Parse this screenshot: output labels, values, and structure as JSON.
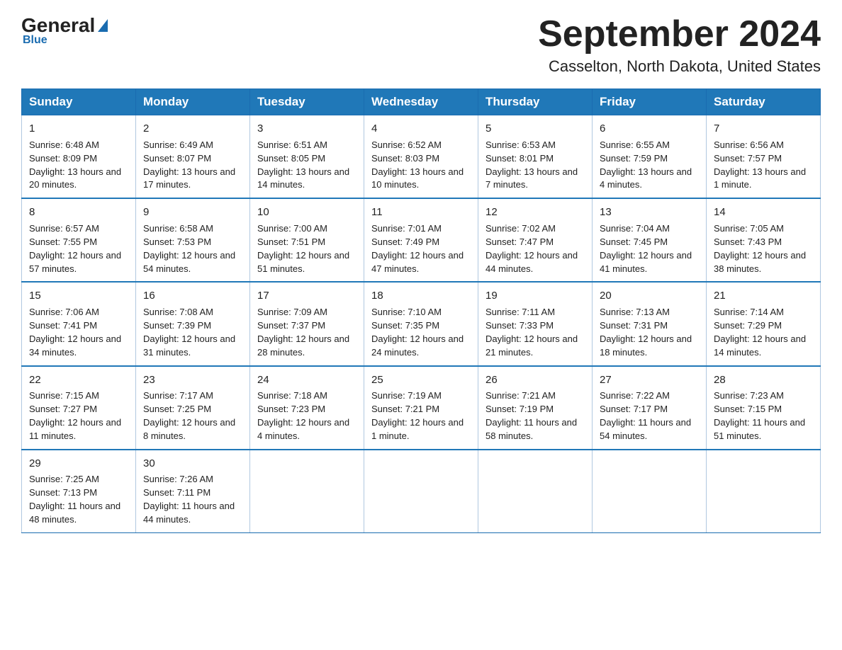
{
  "header": {
    "logo_general": "General",
    "logo_blue": "Blue",
    "month_title": "September 2024",
    "location": "Casselton, North Dakota, United States"
  },
  "days_of_week": [
    "Sunday",
    "Monday",
    "Tuesday",
    "Wednesday",
    "Thursday",
    "Friday",
    "Saturday"
  ],
  "weeks": [
    [
      {
        "day": "1",
        "sunrise": "Sunrise: 6:48 AM",
        "sunset": "Sunset: 8:09 PM",
        "daylight": "Daylight: 13 hours and 20 minutes."
      },
      {
        "day": "2",
        "sunrise": "Sunrise: 6:49 AM",
        "sunset": "Sunset: 8:07 PM",
        "daylight": "Daylight: 13 hours and 17 minutes."
      },
      {
        "day": "3",
        "sunrise": "Sunrise: 6:51 AM",
        "sunset": "Sunset: 8:05 PM",
        "daylight": "Daylight: 13 hours and 14 minutes."
      },
      {
        "day": "4",
        "sunrise": "Sunrise: 6:52 AM",
        "sunset": "Sunset: 8:03 PM",
        "daylight": "Daylight: 13 hours and 10 minutes."
      },
      {
        "day": "5",
        "sunrise": "Sunrise: 6:53 AM",
        "sunset": "Sunset: 8:01 PM",
        "daylight": "Daylight: 13 hours and 7 minutes."
      },
      {
        "day": "6",
        "sunrise": "Sunrise: 6:55 AM",
        "sunset": "Sunset: 7:59 PM",
        "daylight": "Daylight: 13 hours and 4 minutes."
      },
      {
        "day": "7",
        "sunrise": "Sunrise: 6:56 AM",
        "sunset": "Sunset: 7:57 PM",
        "daylight": "Daylight: 13 hours and 1 minute."
      }
    ],
    [
      {
        "day": "8",
        "sunrise": "Sunrise: 6:57 AM",
        "sunset": "Sunset: 7:55 PM",
        "daylight": "Daylight: 12 hours and 57 minutes."
      },
      {
        "day": "9",
        "sunrise": "Sunrise: 6:58 AM",
        "sunset": "Sunset: 7:53 PM",
        "daylight": "Daylight: 12 hours and 54 minutes."
      },
      {
        "day": "10",
        "sunrise": "Sunrise: 7:00 AM",
        "sunset": "Sunset: 7:51 PM",
        "daylight": "Daylight: 12 hours and 51 minutes."
      },
      {
        "day": "11",
        "sunrise": "Sunrise: 7:01 AM",
        "sunset": "Sunset: 7:49 PM",
        "daylight": "Daylight: 12 hours and 47 minutes."
      },
      {
        "day": "12",
        "sunrise": "Sunrise: 7:02 AM",
        "sunset": "Sunset: 7:47 PM",
        "daylight": "Daylight: 12 hours and 44 minutes."
      },
      {
        "day": "13",
        "sunrise": "Sunrise: 7:04 AM",
        "sunset": "Sunset: 7:45 PM",
        "daylight": "Daylight: 12 hours and 41 minutes."
      },
      {
        "day": "14",
        "sunrise": "Sunrise: 7:05 AM",
        "sunset": "Sunset: 7:43 PM",
        "daylight": "Daylight: 12 hours and 38 minutes."
      }
    ],
    [
      {
        "day": "15",
        "sunrise": "Sunrise: 7:06 AM",
        "sunset": "Sunset: 7:41 PM",
        "daylight": "Daylight: 12 hours and 34 minutes."
      },
      {
        "day": "16",
        "sunrise": "Sunrise: 7:08 AM",
        "sunset": "Sunset: 7:39 PM",
        "daylight": "Daylight: 12 hours and 31 minutes."
      },
      {
        "day": "17",
        "sunrise": "Sunrise: 7:09 AM",
        "sunset": "Sunset: 7:37 PM",
        "daylight": "Daylight: 12 hours and 28 minutes."
      },
      {
        "day": "18",
        "sunrise": "Sunrise: 7:10 AM",
        "sunset": "Sunset: 7:35 PM",
        "daylight": "Daylight: 12 hours and 24 minutes."
      },
      {
        "day": "19",
        "sunrise": "Sunrise: 7:11 AM",
        "sunset": "Sunset: 7:33 PM",
        "daylight": "Daylight: 12 hours and 21 minutes."
      },
      {
        "day": "20",
        "sunrise": "Sunrise: 7:13 AM",
        "sunset": "Sunset: 7:31 PM",
        "daylight": "Daylight: 12 hours and 18 minutes."
      },
      {
        "day": "21",
        "sunrise": "Sunrise: 7:14 AM",
        "sunset": "Sunset: 7:29 PM",
        "daylight": "Daylight: 12 hours and 14 minutes."
      }
    ],
    [
      {
        "day": "22",
        "sunrise": "Sunrise: 7:15 AM",
        "sunset": "Sunset: 7:27 PM",
        "daylight": "Daylight: 12 hours and 11 minutes."
      },
      {
        "day": "23",
        "sunrise": "Sunrise: 7:17 AM",
        "sunset": "Sunset: 7:25 PM",
        "daylight": "Daylight: 12 hours and 8 minutes."
      },
      {
        "day": "24",
        "sunrise": "Sunrise: 7:18 AM",
        "sunset": "Sunset: 7:23 PM",
        "daylight": "Daylight: 12 hours and 4 minutes."
      },
      {
        "day": "25",
        "sunrise": "Sunrise: 7:19 AM",
        "sunset": "Sunset: 7:21 PM",
        "daylight": "Daylight: 12 hours and 1 minute."
      },
      {
        "day": "26",
        "sunrise": "Sunrise: 7:21 AM",
        "sunset": "Sunset: 7:19 PM",
        "daylight": "Daylight: 11 hours and 58 minutes."
      },
      {
        "day": "27",
        "sunrise": "Sunrise: 7:22 AM",
        "sunset": "Sunset: 7:17 PM",
        "daylight": "Daylight: 11 hours and 54 minutes."
      },
      {
        "day": "28",
        "sunrise": "Sunrise: 7:23 AM",
        "sunset": "Sunset: 7:15 PM",
        "daylight": "Daylight: 11 hours and 51 minutes."
      }
    ],
    [
      {
        "day": "29",
        "sunrise": "Sunrise: 7:25 AM",
        "sunset": "Sunset: 7:13 PM",
        "daylight": "Daylight: 11 hours and 48 minutes."
      },
      {
        "day": "30",
        "sunrise": "Sunrise: 7:26 AM",
        "sunset": "Sunset: 7:11 PM",
        "daylight": "Daylight: 11 hours and 44 minutes."
      },
      null,
      null,
      null,
      null,
      null
    ]
  ]
}
